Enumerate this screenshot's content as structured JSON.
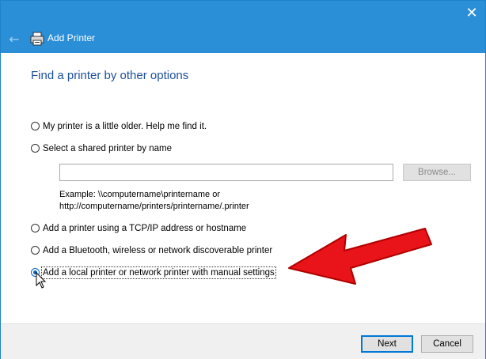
{
  "window": {
    "title": "Add Printer"
  },
  "titlebar": {
    "close_glyph": "✕"
  },
  "nav": {
    "back_glyph": "←",
    "icon": "printer-icon"
  },
  "heading": "Find a printer by other options",
  "options": [
    {
      "label": "My printer is a little older. Help me find it.",
      "checked": false
    },
    {
      "label": "Select a shared printer by name",
      "checked": false
    },
    {
      "label": "Add a printer using a TCP/IP address or hostname",
      "checked": false
    },
    {
      "label": "Add a Bluetooth, wireless or network discoverable printer",
      "checked": false
    },
    {
      "label": "Add a local printer or network printer with manual settings",
      "checked": true
    }
  ],
  "shared_printer": {
    "input_value": "",
    "browse_label": "Browse...",
    "example_line1": "Example: \\\\computername\\printername or",
    "example_line2": "http://computername/printers/printername/.printer"
  },
  "footer": {
    "next_label": "Next",
    "cancel_label": "Cancel"
  },
  "colors": {
    "titlebar": "#2b8fd8",
    "heading": "#1c4f9c",
    "arrow": "#e8141a"
  }
}
